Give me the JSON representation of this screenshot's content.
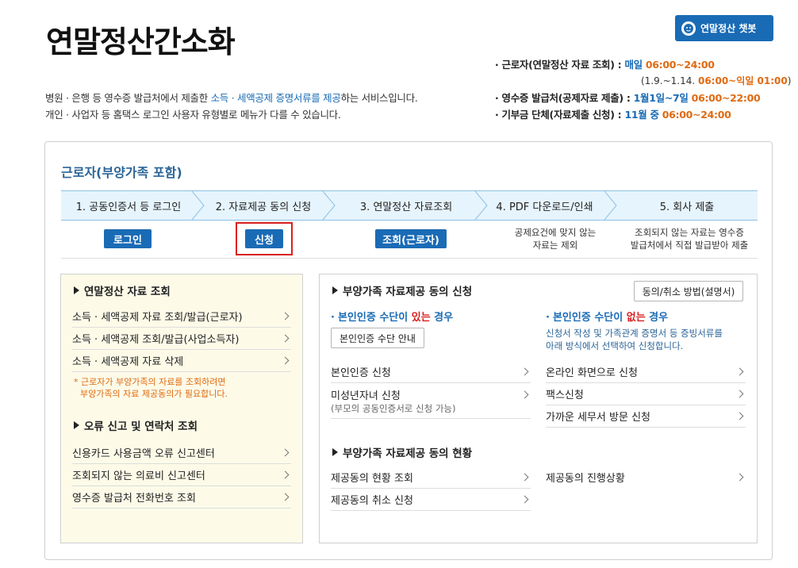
{
  "header": {
    "title": "연말정산간소화",
    "chatbot_label": "연말정산 챗봇",
    "desc_line1_a": "병원 · 은행 등 영수증 발급처에서 제출한 ",
    "desc_line1_hl": "소득 · 세액공제 증명서류를 제공",
    "desc_line1_b": "하는 서비스입니다.",
    "desc_line2": "개인 · 사업자 등 홈택스 로그인 사용자 유형별로 메뉴가 다를 수 있습니다."
  },
  "schedule": {
    "row1_label": "· 근로자(연말정산 자료 조회) : ",
    "row1_v1": "매일 ",
    "row1_v2": "06:00~24:00",
    "row1_sub_a": "(1.9.~1.14. ",
    "row1_sub_b": "06:00~익일 01:00",
    "row1_sub_c": ")",
    "row2_label": "· 영수증 발급처(공제자료 제출) : ",
    "row2_v1": "1월1일~7일 ",
    "row2_v2": "06:00~22:00",
    "row3_label": "· 기부금 단체(자료제출 신청) : ",
    "row3_v1": "11월 중 ",
    "row3_v2": "06:00~24:00"
  },
  "section": {
    "title": "근로자(부양가족 포함)",
    "steps": [
      {
        "label": "1. 공동인증서 등 로그인"
      },
      {
        "label": "2. 자료제공 동의 신청"
      },
      {
        "label": "3. 연말정산 자료조회"
      },
      {
        "label": "4. PDF 다운로드/인쇄"
      },
      {
        "label": "5. 회사 제출"
      }
    ],
    "step_buttons": {
      "login": "로그인",
      "apply": "신청",
      "lookup": "조회(근로자)"
    },
    "step_notes": {
      "step4_line1": "공제요건에 맞지 않는",
      "step4_line2": "자료는 제외",
      "step5_line1": "조회되지 않는 자료는 영수증",
      "step5_line2": "발급처에서 직접 발급받아 제출"
    }
  },
  "left": {
    "title1": "연말정산 자료 조회",
    "links1": [
      "소득 · 세액공제 자료 조회/발급(근로자)",
      "소득 · 세액공제 조회/발급(사업소득자)",
      "소득 · 세액공제 자료 삭제"
    ],
    "note_line1": "* 근로자가 부양가족의 자료를 조회하려면",
    "note_line2": "부양가족의 자료 제공동의가 필요합니다.",
    "title2": "오류 신고 및 연락처 조회",
    "links2": [
      "신용카드 사용금액 오류 신고센터",
      "조회되지 않는 의료비 신고센터",
      "영수증 발급처 전화번호 조회"
    ]
  },
  "right": {
    "title1": "부양가족 자료제공 동의 신청",
    "method_btn": "동의/취소 방법(설명서)",
    "case1_a": "본인인증 수단이 ",
    "case1_b": "있는",
    "case1_c": " 경우",
    "auth_btn": "본인인증 수단 안내",
    "case2_a": "본인인증 수단이 ",
    "case2_b": "없는",
    "case2_c": " 경우",
    "case2_desc1": "신청서 작성 및 가족관계 증명서 등 증빙서류를",
    "case2_desc2": "아래 방식에서 선택하여 신청합니다.",
    "left_links": [
      "본인인증 신청",
      "미성년자녀 신청"
    ],
    "minor_sub": "(부모의 공동인증서로 신청 가능)",
    "right_links": [
      "온라인 화면으로 신청",
      "팩스신청",
      "가까운 세무서 방문 신청"
    ],
    "title2": "부양가족 자료제공 동의 현황",
    "status_links": [
      "제공동의 현황 조회",
      "제공동의 취소 신청"
    ],
    "progress_link": "제공동의 진행상황"
  }
}
